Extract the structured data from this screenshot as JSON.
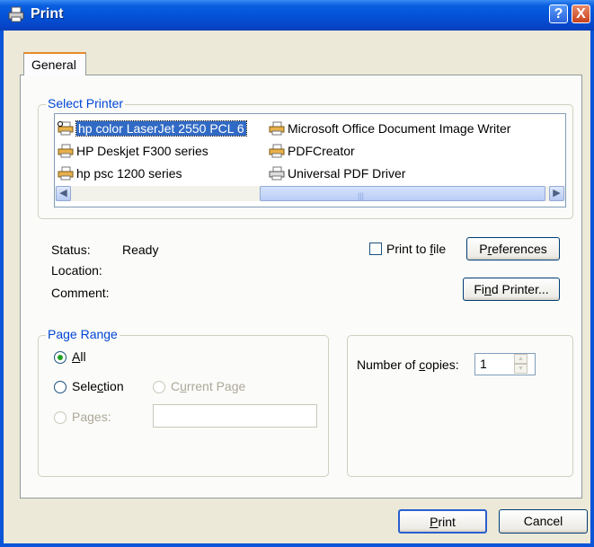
{
  "window": {
    "title": "Print",
    "help_glyph": "?",
    "close_glyph": "X"
  },
  "tabs": [
    {
      "label": "General"
    }
  ],
  "select_printer": {
    "legend": "Select Printer",
    "printers": [
      {
        "name": "hp color LaserJet 2550 PCL 6",
        "selected": true,
        "icon": "printer-icon"
      },
      {
        "name": "HP Deskjet F300 series",
        "icon": "printer-icon"
      },
      {
        "name": "hp psc 1200 series",
        "icon": "printer-icon"
      },
      {
        "name": "Microsoft Office Document Image Writer",
        "icon": "printer-icon"
      },
      {
        "name": "PDFCreator",
        "icon": "printer-icon"
      },
      {
        "name": "Universal PDF Driver",
        "icon": "printer-icon"
      }
    ],
    "status_label": "Status:",
    "status_value": "Ready",
    "location_label": "Location:",
    "location_value": "",
    "comment_label": "Comment:",
    "comment_value": "",
    "print_to_file_pre": "Print to ",
    "print_to_file_key": "f",
    "print_to_file_post": "ile",
    "print_to_file_checked": false,
    "preferences_pre": "P",
    "preferences_key": "r",
    "preferences_post": "eferences",
    "find_printer_pre": "Fi",
    "find_printer_key": "n",
    "find_printer_post": "d Printer..."
  },
  "page_range": {
    "legend": "Page Range",
    "all_key": "A",
    "all_post": "ll",
    "selection_pre": "Sele",
    "selection_key": "c",
    "selection_post": "tion",
    "current_page_pre": "C",
    "current_page_key": "u",
    "current_page_post": "rrent Page",
    "pages_pre": "Pa",
    "pages_key": "g",
    "pages_post": "es:",
    "pages_value": "",
    "selected_option": "All"
  },
  "copies": {
    "label_pre": "Number of ",
    "label_key": "c",
    "label_post": "opies:",
    "value": "1"
  },
  "buttons": {
    "print_key": "P",
    "print_post": "rint",
    "cancel": "Cancel"
  },
  "colors": {
    "title_bar": "#0453d8",
    "dialog_bg": "#ece9d8",
    "accent_text": "#0046d5",
    "selection": "#316ac5"
  }
}
